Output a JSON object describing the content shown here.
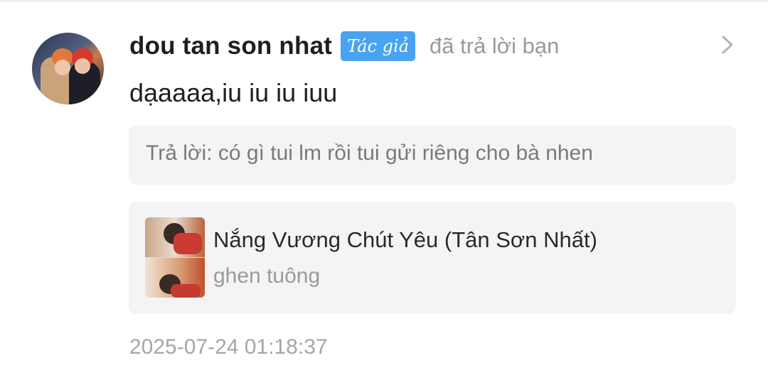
{
  "notification": {
    "username": "dou tan son nhat",
    "author_badge": "Tác giả",
    "action_text": "đã trả lời bạn",
    "comment": "dạaaaa,iu iu iu iuu",
    "reply": "Trả lời: có gì tui lm rồi tui gửi riêng cho bà nhen",
    "song": {
      "title": "Nắng Vương Chút Yêu (Tân Sơn Nhất)",
      "subtitle": "ghen tuông"
    },
    "timestamp": "2025-07-24 01:18:37"
  },
  "icons": {
    "chevron": "chevron-right-icon"
  },
  "colors": {
    "badge": "#4aa3f0",
    "box_bg": "#f4f4f6",
    "muted_text": "#9a9a9a"
  }
}
